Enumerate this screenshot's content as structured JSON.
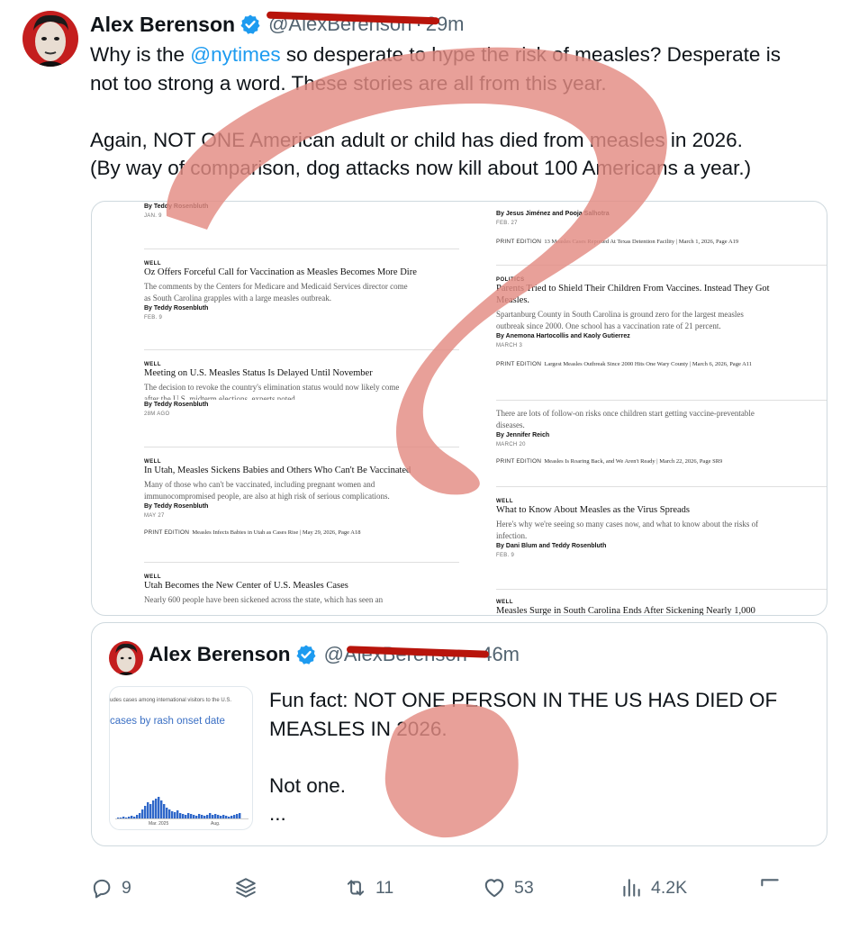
{
  "tweet": {
    "author_name": "Alex Berenson",
    "handle": "@AlexBerenson",
    "time": "29m",
    "text_lines": [
      {
        "before": "Why is the ",
        "mention": "@nytimes",
        "after": " so desperate to hype the risk of measles? Desperate is"
      },
      {
        "text": "not too strong a word. These stories are all from this year."
      },
      {
        "text": "Again, NOT ONE American adult or child has died from measles in 2026."
      },
      {
        "text": "(By way of comparison, dog attacks now kill about 100 Americans a year.)"
      }
    ]
  },
  "articles": {
    "left": [
      {
        "byline": "By Teddy Rosenbluth",
        "date": "JAN. 9"
      },
      {
        "kicker": "WELL",
        "headline": "Oz Offers Forceful Call for Vaccination as Measles Becomes More Dire",
        "summary": [
          "The comments by the Centers for Medicare and Medicaid Services director come",
          "as South Carolina grapples with a large measles outbreak."
        ],
        "byline": "By Teddy Rosenbluth",
        "date": "FEB. 9"
      },
      {
        "kicker": "WELL",
        "headline": "Meeting on U.S. Measles Status Is Delayed Until November",
        "summary": [
          "The decision to revoke the country's elimination status would now likely come",
          "after the U.S. midterm elections, experts noted."
        ],
        "byline": "By Teddy Rosenbluth",
        "date": "28M AGO"
      },
      {
        "kicker": "WELL",
        "headline": "In Utah, Measles Sickens Babies and Others Who Can't Be Vaccinated",
        "summary": [
          "Many of those who can't be vaccinated, including pregnant women and",
          "immunocompromised people, are also at high risk of serious complications."
        ],
        "byline": "By Teddy Rosenbluth",
        "date": "MAY 27",
        "print_label": "PRINT EDITION",
        "print": "Measles Infects Babies in Utah as Cases Rise | May 29, 2026, Page A18"
      },
      {
        "kicker": "WELL",
        "headline": "Utah Becomes the New Center of U.S. Measles Cases",
        "summary": [
          "Nearly 600 people have been sickened across the state, which has seen an"
        ]
      }
    ],
    "right": [
      {
        "byline": "By Jesus Jiménez and Pooja Salhotra",
        "date": "FEB. 27",
        "print_label": "PRINT EDITION",
        "print": "13 Measles Cases Reported At Texas Detention Facility | March 1, 2026, Page A19"
      },
      {
        "kicker": "POLITICS",
        "headline_lines": [
          "Parents Tried to Shield Their Children From Vaccines. Instead They Got",
          "Measles."
        ],
        "summary": [
          "Spartanburg County in South Carolina is ground zero for the largest measles",
          "outbreak since 2000. One school has a vaccination rate of 21 percent."
        ],
        "byline": "By Anemona Hartocollis and Kaoly Gutierrez",
        "date": "MARCH 3",
        "print_label": "PRINT EDITION",
        "print": "Largest Measles Outbreak Since 2000 Hits One Wary County | March 6, 2026, Page A11"
      },
      {
        "summary": [
          "There are lots of follow-on risks once children start getting vaccine-preventable",
          "diseases."
        ],
        "byline": "By Jennifer Reich",
        "date": "MARCH 20",
        "print_label": "PRINT EDITION",
        "print": "Measles Is Roaring Back, and We Aren't Ready | March 22, 2026, Page SR9"
      },
      {
        "kicker": "WELL",
        "headline": "What to Know About Measles as the Virus Spreads",
        "summary": [
          "Here's why we're seeing so many cases now, and what to know about the risks of",
          "infection."
        ],
        "byline": "By Dani Blum and Teddy Rosenbluth",
        "date": "FEB. 9"
      },
      {
        "kicker": "WELL",
        "headline": "Measles Surge in South Carolina Ends After Sickening Nearly 1,000"
      }
    ]
  },
  "quote": {
    "author_name": "Alex Berenson",
    "handle": "@AlexBerenson",
    "time": "46m",
    "thumb_caption": "udes cases among international visitors to the U.S.",
    "thumb_title": "cases by rash onset date",
    "thumb_axis": [
      "Mar. 2025",
      "Aug."
    ],
    "text_lines": [
      "Fun fact: NOT ONE PERSON IN THE US HAS DIED OF",
      "MEASLES IN 2026.",
      "",
      "Not one.",
      "..."
    ]
  },
  "actions": {
    "replies": "9",
    "reposts": "11",
    "likes": "53",
    "views": "4.2K"
  },
  "colors": {
    "accent": "#1d9bf0",
    "redaction": "#b8140b",
    "overlay": "#e38b82"
  },
  "icons": [
    "reply-icon",
    "stack-icon",
    "repost-icon",
    "heart-icon",
    "views-icon",
    "verified-badge-icon"
  ]
}
